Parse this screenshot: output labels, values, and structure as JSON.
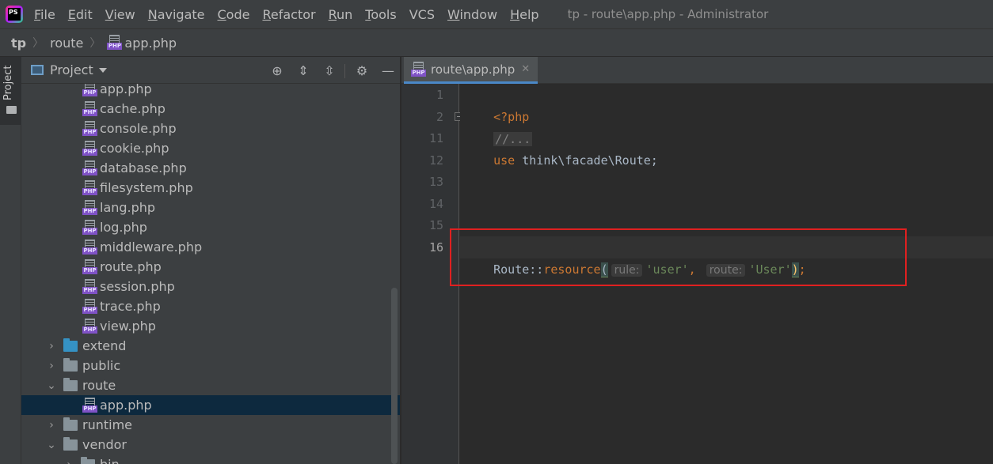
{
  "menubar": {
    "logo_text": "PS",
    "items": [
      {
        "u": "F",
        "rest": "ile"
      },
      {
        "u": "E",
        "rest": "dit"
      },
      {
        "u": "V",
        "rest": "iew"
      },
      {
        "u": "N",
        "rest": "avigate"
      },
      {
        "u": "C",
        "rest": "ode"
      },
      {
        "u": "R",
        "rest": "efactor"
      },
      {
        "u": "R",
        "rest": "un",
        "extra": ""
      },
      {
        "u": "T",
        "rest": "ools"
      },
      {
        "u": "",
        "rest": "VCS"
      },
      {
        "u": "W",
        "rest": "indow"
      },
      {
        "u": "H",
        "rest": "elp"
      }
    ],
    "window_title": "tp - route\\app.php - Administrator"
  },
  "breadcrumb": {
    "project": "tp",
    "folder": "route",
    "file": "app.php"
  },
  "tool_strip": {
    "project_label": "Project"
  },
  "project_panel": {
    "title": "Project",
    "rows": [
      {
        "label": "app.php",
        "type": "php"
      },
      {
        "label": "cache.php",
        "type": "php"
      },
      {
        "label": "console.php",
        "type": "php"
      },
      {
        "label": "cookie.php",
        "type": "php"
      },
      {
        "label": "database.php",
        "type": "php"
      },
      {
        "label": "filesystem.php",
        "type": "php"
      },
      {
        "label": "lang.php",
        "type": "php"
      },
      {
        "label": "log.php",
        "type": "php"
      },
      {
        "label": "middleware.php",
        "type": "php"
      },
      {
        "label": "route.php",
        "type": "php"
      },
      {
        "label": "session.php",
        "type": "php"
      },
      {
        "label": "trace.php",
        "type": "php"
      },
      {
        "label": "view.php",
        "type": "php"
      },
      {
        "label": "extend",
        "type": "folder-blue",
        "arrow": "›"
      },
      {
        "label": "public",
        "type": "folder",
        "arrow": "›"
      },
      {
        "label": "route",
        "type": "folder",
        "arrow": "⌄"
      },
      {
        "label": "app.php",
        "type": "php",
        "selected": true
      },
      {
        "label": "runtime",
        "type": "folder",
        "arrow": "›"
      },
      {
        "label": "vendor",
        "type": "folder",
        "arrow": "⌄"
      },
      {
        "label": "bin",
        "type": "folder",
        "arrow": "›"
      }
    ]
  },
  "editor": {
    "tab_label": "route\\app.php",
    "line_numbers": [
      "1",
      "2",
      "11",
      "12",
      "13",
      "14",
      "15",
      "16"
    ],
    "lines": {
      "l1": "<?php",
      "l2": "//...",
      "l3_kw": "use",
      "l3_rest": " think\\facade\\Route;",
      "l8_class": "Route",
      "l8_op": "::",
      "l8_fn": "resource",
      "l8_open": "(",
      "l8_hint1": "rule:",
      "l8_arg1": "'user'",
      "l8_comma": ",",
      "l8_hint2": "route:",
      "l8_arg2": "'User'",
      "l8_close": ")",
      "l8_semi": ";"
    }
  },
  "colors": {
    "accent": "#4a88c7",
    "highlight_box": "#e02020",
    "keyword": "#cc7832",
    "string": "#6a8759",
    "function": "#ffc66d"
  }
}
